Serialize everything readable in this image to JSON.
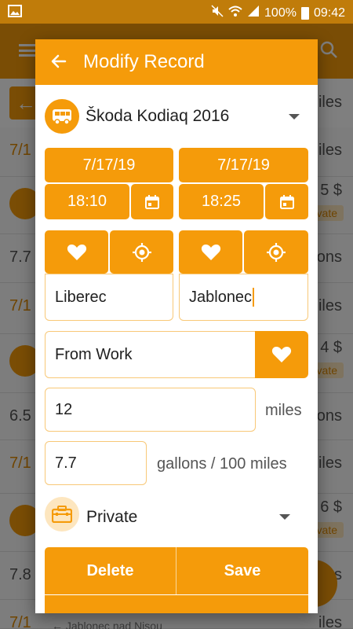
{
  "status_bar": {
    "battery": "100%",
    "time": "09:42"
  },
  "background": {
    "rows": [
      {
        "left": "7/1",
        "right": "iles",
        "tone": "orange"
      },
      {
        "left": "",
        "right": "5 $",
        "badge": "ivate",
        "bus": true
      },
      {
        "left": "7.7",
        "right": "ons",
        "tone": "dark"
      },
      {
        "left": "7/1",
        "right": "iles",
        "tone": "orange"
      },
      {
        "left": "",
        "right": "4 $",
        "badge": "ivate",
        "bus": true
      },
      {
        "left": "6.5",
        "right": "ons",
        "tone": "dark"
      },
      {
        "left": "7/1",
        "right": "iles",
        "tone": "orange"
      },
      {
        "left": "",
        "right": "6 $",
        "badge": "ivate",
        "bus": true
      },
      {
        "left": "7.8",
        "right": "ons",
        "tone": "dark"
      },
      {
        "left": "7/1",
        "right": "iles",
        "tone": "orange"
      }
    ],
    "subbar_right": "iles",
    "footer_text": "Jablonec nad Nisou"
  },
  "dialog": {
    "title": "Modify Record",
    "vehicle": {
      "name": "Škoda Kodiaq 2016",
      "icon": "bus-icon"
    },
    "start": {
      "date": "7/17/19",
      "time": "18:10"
    },
    "end": {
      "date": "7/17/19",
      "time": "18:25"
    },
    "origin": "Liberec",
    "destination": "Jablonec",
    "purpose": "From Work",
    "distance": {
      "value": "12",
      "unit": "miles"
    },
    "consumption": {
      "value": "7.7",
      "unit": "gallons / 100 miles"
    },
    "trip_type": {
      "label": "Private",
      "icon": "briefcase-icon"
    },
    "actions": {
      "delete": "Delete",
      "save": "Save"
    }
  },
  "colors": {
    "accent": "#f59b0a",
    "accent_dark": "#c07c0a",
    "field_border": "#f8c877"
  }
}
